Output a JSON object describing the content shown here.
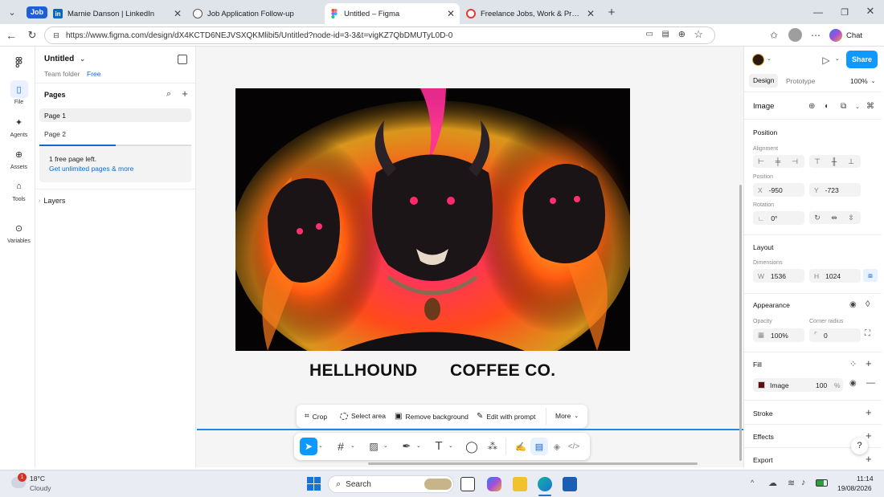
{
  "browser": {
    "tabs": [
      {
        "label": "Job",
        "kind": "group"
      },
      {
        "label": "Marnie Danson | LinkedIn",
        "favicon": "linkedin-icon"
      },
      {
        "label": "Job Application Follow-up",
        "favicon": "globe-icon"
      },
      {
        "label": "Untitled – Figma",
        "favicon": "figma-icon",
        "active": true
      },
      {
        "label": "Freelance Jobs, Work & Projects in",
        "favicon": "freelancer-icon"
      }
    ],
    "url": "https://www.figma.com/design/dX4KCTD6NEJVSXQKMlibi5/Untitled?node-id=3-3&t=vigKZ7QbDMUTyL0D-0",
    "chat_label": "Chat"
  },
  "figma": {
    "rail": [
      {
        "label": "File",
        "icon": "file-icon"
      },
      {
        "label": "Agents",
        "icon": "sparkle-icon"
      },
      {
        "label": "Assets",
        "icon": "assets-icon"
      },
      {
        "label": "Tools",
        "icon": "tools-icon"
      },
      {
        "label": "Variables",
        "icon": "variables-icon"
      }
    ],
    "file": {
      "title": "Untitled",
      "folder": "Team folder",
      "plan": "Free"
    },
    "pages": {
      "heading": "Pages",
      "items": [
        "Page 1",
        "Page 2"
      ],
      "notice": "1 free page left.",
      "upgrade_link": "Get unlimited pages & more",
      "usage_fraction": 0.5
    },
    "layers_heading": "Layers",
    "canvas": {
      "headline_left": "HELLHOUND",
      "headline_right": "COFFEE CO.",
      "image_toolbar": [
        "Crop",
        "Select area",
        "Remove background",
        "Edit with prompt",
        "More"
      ]
    },
    "design_panel": {
      "share": "Share",
      "tabs": [
        "Design",
        "Prototype"
      ],
      "zoom": "100%",
      "layer_type": "Image",
      "position": {
        "heading": "Position",
        "alignment_label": "Alignment",
        "position_label": "Position",
        "x_key": "X",
        "x": "-950",
        "y_key": "Y",
        "y": "-723",
        "rotation_label": "Rotation",
        "rotation": "0°"
      },
      "layout": {
        "heading": "Layout",
        "dimensions_label": "Dimensions",
        "w_key": "W",
        "w": "1536",
        "h_key": "H",
        "h": "1024"
      },
      "appearance": {
        "heading": "Appearance",
        "opacity_label": "Opacity",
        "opacity": "100%",
        "radius_label": "Corner radius",
        "radius": "0"
      },
      "fill": {
        "heading": "Fill",
        "name": "Image",
        "opacity": "100",
        "unit": "%"
      },
      "stroke": "Stroke",
      "effects": "Effects",
      "export": "Export",
      "help": "?"
    }
  },
  "taskbar": {
    "weather_temp": "18°C",
    "weather_desc": "Cloudy",
    "weather_badge": "1",
    "search": "Search",
    "time": "11:14",
    "date": "19/08/2026"
  }
}
